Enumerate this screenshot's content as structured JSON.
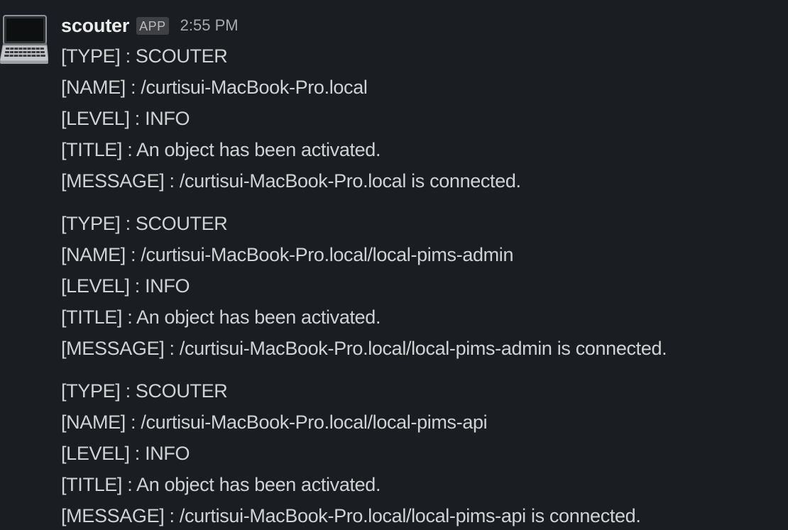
{
  "message": {
    "avatar_icon": "laptop-icon",
    "sender": "scouter",
    "badge": "APP",
    "timestamp": "2:55 PM",
    "blocks": [
      {
        "type": "[TYPE] : SCOUTER",
        "name": "[NAME] : /curtisui-MacBook-Pro.local",
        "level": "[LEVEL] : INFO",
        "title": "[TITLE] : An object has been activated.",
        "message": "[MESSAGE] : /curtisui-MacBook-Pro.local is connected."
      },
      {
        "type": "[TYPE] : SCOUTER",
        "name": "[NAME] : /curtisui-MacBook-Pro.local/local-pims-admin",
        "level": "[LEVEL] : INFO",
        "title": "[TITLE] : An object has been activated.",
        "message": "[MESSAGE] : /curtisui-MacBook-Pro.local/local-pims-admin is connected."
      },
      {
        "type": "[TYPE] : SCOUTER",
        "name": "[NAME] : /curtisui-MacBook-Pro.local/local-pims-api",
        "level": "[LEVEL] : INFO",
        "title": "[TITLE] : An object has been activated.",
        "message": "[MESSAGE] : /curtisui-MacBook-Pro.local/local-pims-api is connected."
      }
    ]
  },
  "colors": {
    "background": "#1a1d21",
    "sender": "#ececec",
    "text": "#d1d2d3",
    "badge_bg": "#3e4044",
    "timestamp": "#a9aaac"
  }
}
